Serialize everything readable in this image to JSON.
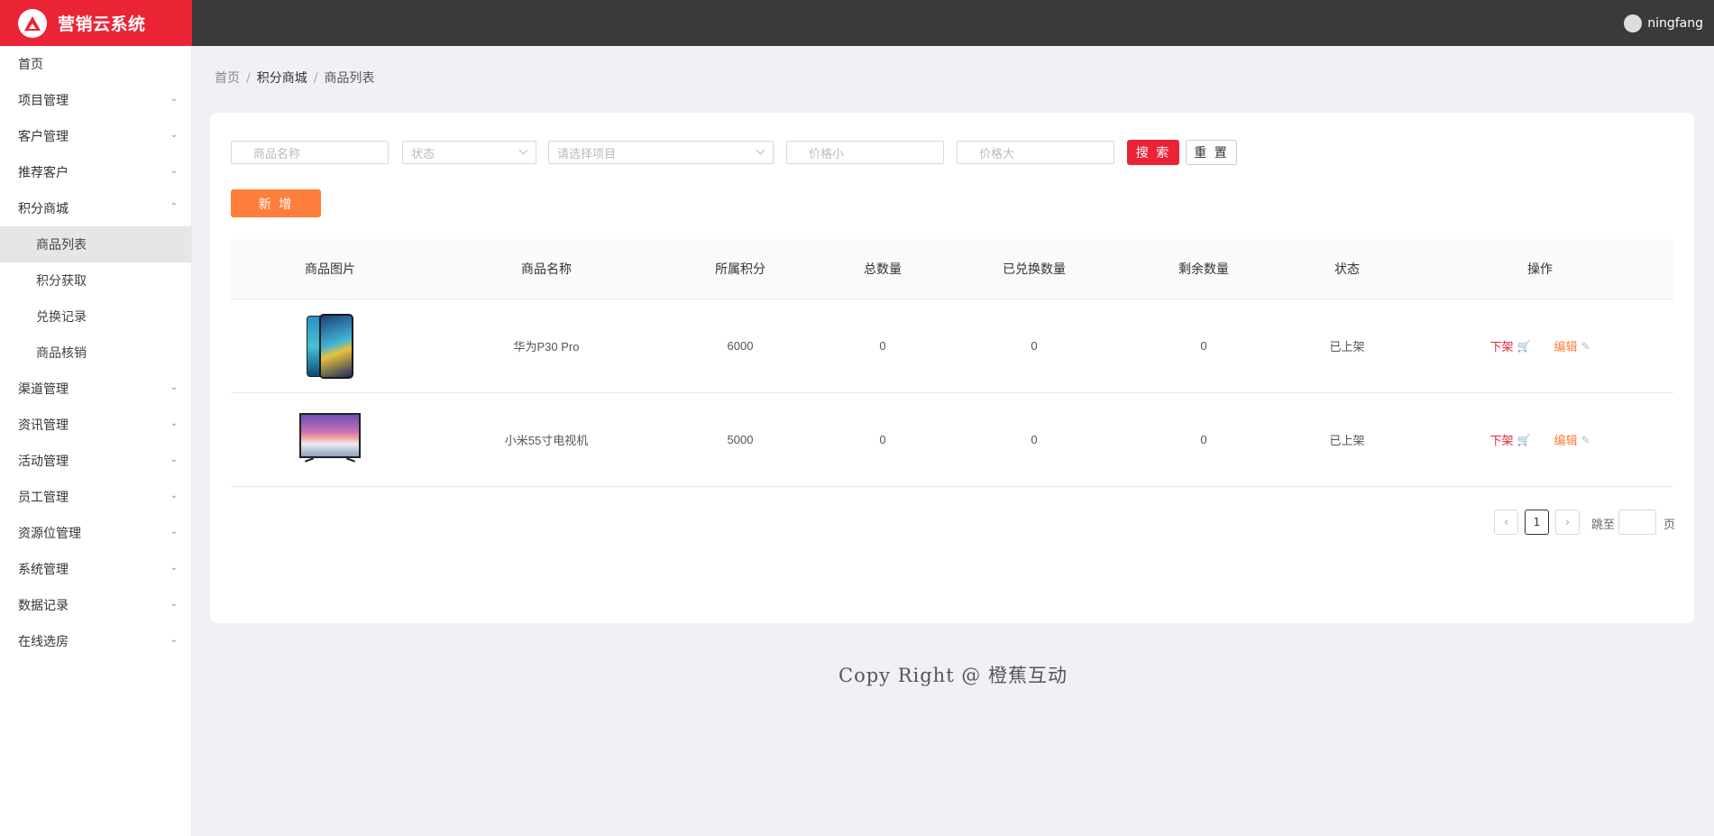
{
  "app": {
    "title": "营销云系统",
    "user": "ningfang"
  },
  "sidebar": {
    "items": [
      {
        "label": "首页",
        "has_chevron": false
      },
      {
        "label": "项目管理",
        "has_chevron": true
      },
      {
        "label": "客户管理",
        "has_chevron": true
      },
      {
        "label": "推荐客户",
        "has_chevron": true
      },
      {
        "label": "积分商城",
        "has_chevron": true,
        "expanded": true,
        "children": [
          "商品列表",
          "积分获取",
          "兑换记录",
          "商品核销"
        ]
      },
      {
        "label": "渠道管理",
        "has_chevron": true
      },
      {
        "label": "资讯管理",
        "has_chevron": true
      },
      {
        "label": "活动管理",
        "has_chevron": true
      },
      {
        "label": "员工管理",
        "has_chevron": true
      },
      {
        "label": "资源位管理",
        "has_chevron": true
      },
      {
        "label": "系统管理",
        "has_chevron": true
      },
      {
        "label": "数据记录",
        "has_chevron": true
      },
      {
        "label": "在线选房",
        "has_chevron": true
      }
    ],
    "active_child": "商品列表"
  },
  "breadcrumb": {
    "home": "首页",
    "section": "积分商城",
    "current": "商品列表"
  },
  "filters": {
    "name_placeholder": "商品名称",
    "status_placeholder": "状态",
    "project_placeholder": "请选择项目",
    "price_min_placeholder": "价格小",
    "price_max_placeholder": "价格大",
    "search_label": "搜 索",
    "reset_label": "重 置"
  },
  "actions": {
    "add_label": "新 增"
  },
  "table": {
    "columns": [
      "商品图片",
      "商品名称",
      "所属积分",
      "总数量",
      "已兑换数量",
      "剩余数量",
      "状态",
      "操作"
    ],
    "rows": [
      {
        "image": "phone-image",
        "name": "华为P30 Pro",
        "points": "6000",
        "total": "0",
        "redeemed": "0",
        "remaining": "0",
        "status": "已上架",
        "op_down": "下架",
        "op_edit": "编辑"
      },
      {
        "image": "tv-image",
        "name": "小米55寸电视机",
        "points": "5000",
        "total": "0",
        "redeemed": "0",
        "remaining": "0",
        "status": "已上架",
        "op_down": "下架",
        "op_edit": "编辑"
      }
    ]
  },
  "pagination": {
    "prev": "‹",
    "current": "1",
    "next": "›",
    "jump_label": "跳至",
    "page_label": "页"
  },
  "footer": {
    "text": "Copy Right @ 橙蕉互动"
  },
  "colors": {
    "brand_red": "#ea2435",
    "accent_orange": "#ff7e3b",
    "header_bg": "#3a3a3a"
  }
}
